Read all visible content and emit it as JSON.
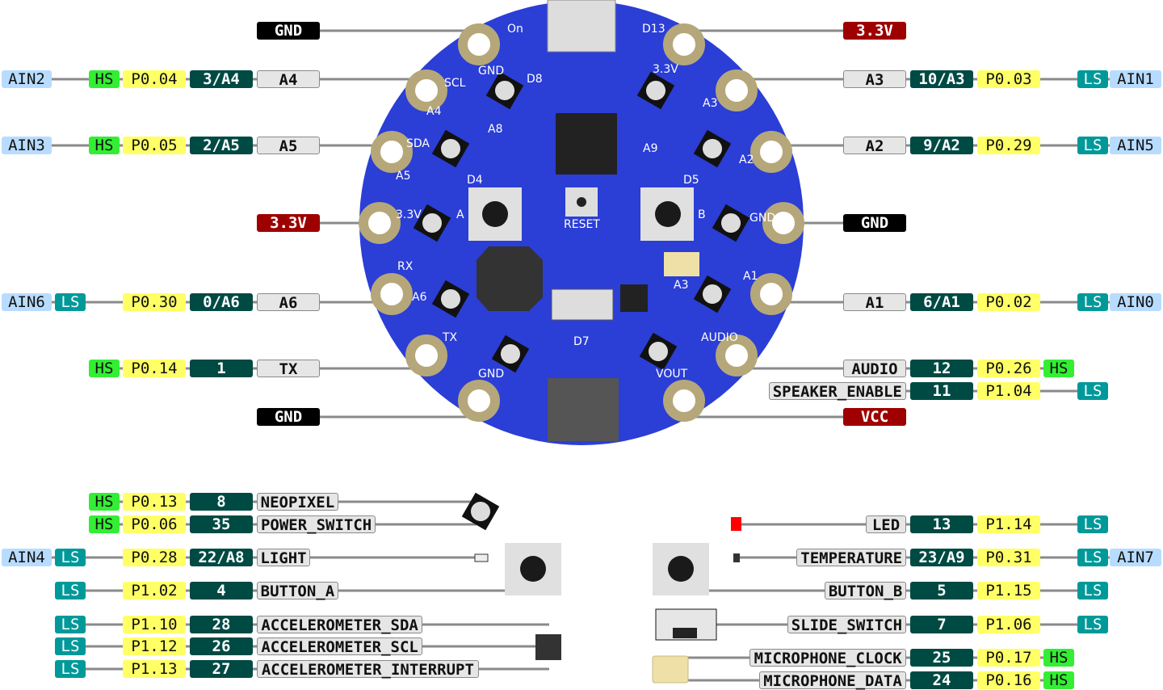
{
  "colors": {
    "board": "#2b3ed6",
    "pad": "#b5a77a",
    "name_bg": "#e6e6e6",
    "gpio_bg": "#004a44",
    "port_bg": "#ffff66",
    "hs_bg": "#33ee33",
    "ls_bg": "#009999",
    "ain_bg": "#b8dcff",
    "gnd_bg": "#000000",
    "power_bg": "#9e0000",
    "wire": "#888888"
  },
  "left_pins": [
    {
      "power": "GND"
    },
    {
      "name": "A4",
      "gpio": "3/A4",
      "port": "P0.04",
      "drive": "HS",
      "analog": "AIN2"
    },
    {
      "name": "A5",
      "gpio": "2/A5",
      "port": "P0.05",
      "drive": "HS",
      "analog": "AIN3"
    },
    {
      "power": "3.3V"
    },
    {
      "name": "A6",
      "gpio": "0/A6",
      "port": "P0.30",
      "drive": "LS",
      "analog": "AIN6"
    },
    {
      "name": "TX",
      "gpio": "1",
      "port": "P0.14",
      "drive": "HS"
    },
    {
      "power": "GND"
    }
  ],
  "right_pins": [
    {
      "power": "3.3V"
    },
    {
      "name": "A3",
      "gpio": "10/A3",
      "port": "P0.03",
      "drive": "LS",
      "analog": "AIN1"
    },
    {
      "name": "A2",
      "gpio": "9/A2",
      "port": "P0.29",
      "drive": "LS",
      "analog": "AIN5"
    },
    {
      "power": "GND"
    },
    {
      "name": "A1",
      "gpio": "6/A1",
      "port": "P0.02",
      "drive": "LS",
      "analog": "AIN0"
    },
    {
      "name": "AUDIO",
      "gpio": "12",
      "port": "P0.26",
      "drive": "HS"
    },
    {
      "name": "SPEAKER_ENABLE",
      "gpio": "11",
      "port": "P1.04",
      "drive": "LS"
    },
    {
      "power": "VCC"
    }
  ],
  "bottom_left": [
    {
      "name": "NEOPIXEL",
      "gpio": "8",
      "port": "P0.13",
      "drive": "HS"
    },
    {
      "name": "POWER_SWITCH",
      "gpio": "35",
      "port": "P0.06",
      "drive": "HS"
    },
    {
      "name": "LIGHT",
      "gpio": "22/A8",
      "port": "P0.28",
      "drive": "LS",
      "analog": "AIN4"
    },
    {
      "name": "BUTTON_A",
      "gpio": "4",
      "port": "P1.02",
      "drive": "LS"
    },
    {
      "name": "ACCELEROMETER_SDA",
      "gpio": "28",
      "port": "P1.10",
      "drive": "LS"
    },
    {
      "name": "ACCELEROMETER_SCL",
      "gpio": "26",
      "port": "P1.12",
      "drive": "LS"
    },
    {
      "name": "ACCELEROMETER_INTERRUPT",
      "gpio": "27",
      "port": "P1.13",
      "drive": "LS"
    }
  ],
  "bottom_right": [
    {
      "name": "LED",
      "gpio": "13",
      "port": "P1.14",
      "drive": "LS"
    },
    {
      "name": "TEMPERATURE",
      "gpio": "23/A9",
      "port": "P0.31",
      "drive": "LS",
      "analog": "AIN7"
    },
    {
      "name": "BUTTON_B",
      "gpio": "5",
      "port": "P1.15",
      "drive": "LS"
    },
    {
      "name": "SLIDE_SWITCH",
      "gpio": "7",
      "port": "P1.06",
      "drive": "LS"
    },
    {
      "name": "MICROPHONE_CLOCK",
      "gpio": "25",
      "port": "P0.17",
      "drive": "HS"
    },
    {
      "name": "MICROPHONE_DATA",
      "gpio": "24",
      "port": "P0.16",
      "drive": "HS"
    }
  ],
  "silkscreen": [
    "On",
    "D13",
    "GND",
    "D8",
    "3.3V",
    "SCL",
    "A4",
    "A3",
    "A8",
    "A9",
    "SDA",
    "A5",
    "A2",
    "D4",
    "D5",
    "3.3V",
    "A",
    "RESET",
    "B",
    "GND",
    "RX",
    "A6",
    "A3",
    "A1",
    "TX",
    "D7",
    "AUDIO",
    "GND",
    "VOUT"
  ]
}
